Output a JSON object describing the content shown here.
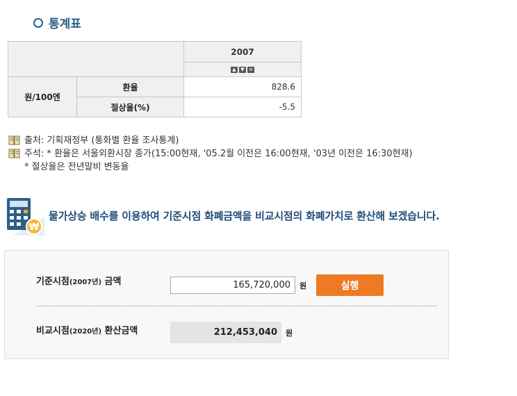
{
  "section": {
    "title": "통계표"
  },
  "table": {
    "year": "2007",
    "unit": "원/100엔",
    "rows": [
      {
        "label": "환율",
        "value": "828.6"
      },
      {
        "label": "절상율(%)",
        "value": "-5.5"
      }
    ],
    "controls": [
      "up-arrow-icon",
      "down-arrow-icon",
      "menu-icon"
    ]
  },
  "notes": {
    "source_label": "출처",
    "source_text": " : 기획재정부 (통화별 환율 조사통계)",
    "note_label": "주석",
    "note_text": " : * 환율은 서울외환시장 종가(15:00현재, '05.2월 이전은 16:00현재, '03년 이전은 16:30현재)",
    "note_text2": "* 절상율은 전년말비 변동율"
  },
  "calculator": {
    "headline": "물가상승 배수를 이용하여 기준시점 화폐금액을 비교시점의 화폐가치로 환산해 보겠습니다.",
    "base_label_main": "기준시점",
    "base_label_year": "(2007년)",
    "base_label_tail": " 금액",
    "base_value": "165,720,000",
    "currency": "원",
    "run_button": "실행",
    "compare_label_main": "비교시점",
    "compare_label_year": "(2020년)",
    "compare_label_tail": " 환산금액",
    "compare_value": "212,453,040",
    "icon": "calculator-won-icon"
  },
  "colors": {
    "accent": "#ee7a24",
    "title": "#2a5e86",
    "headline": "#1f4e79"
  }
}
